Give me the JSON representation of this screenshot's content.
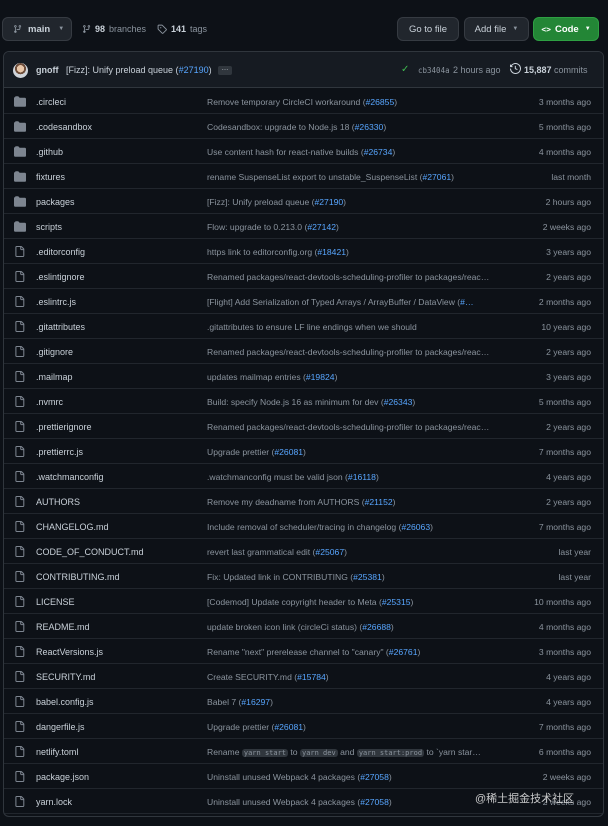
{
  "toolbar": {
    "branch": "main",
    "branches_count": "98",
    "branches_label": "branches",
    "tags_count": "141",
    "tags_label": "tags",
    "goto_file": "Go to file",
    "add_file": "Add file",
    "code": "Code"
  },
  "commit": {
    "author": "gnoff",
    "message_pre": "[Fizz]: Unify preload queue (",
    "message_pr": "#27190",
    "message_post": ")",
    "ellipsis": "…",
    "sha": "cb3404a",
    "time": "2 hours ago",
    "count": "15,887",
    "count_label": "commits"
  },
  "files": [
    {
      "type": "dir",
      "name": ".circleci",
      "msg": "Remove temporary CircleCI workaround (",
      "pr": "#26855",
      "msg_post": ")",
      "age": "3 months ago"
    },
    {
      "type": "dir",
      "name": ".codesandbox",
      "msg": "Codesandbox: upgrade to Node.js 18 (",
      "pr": "#26330",
      "msg_post": ")",
      "age": "5 months ago"
    },
    {
      "type": "dir",
      "name": ".github",
      "msg": "Use content hash for react-native builds (",
      "pr": "#26734",
      "msg_post": ")",
      "age": "4 months ago"
    },
    {
      "type": "dir",
      "name": "fixtures",
      "msg": "rename SuspenseList export to unstable_SuspenseList (",
      "pr": "#27061",
      "msg_post": ")",
      "age": "last month"
    },
    {
      "type": "dir",
      "name": "packages",
      "msg": "[Fizz]: Unify preload queue (",
      "pr": "#27190",
      "msg_post": ")",
      "age": "2 hours ago"
    },
    {
      "type": "dir",
      "name": "scripts",
      "msg": "Flow: upgrade to 0.213.0 (",
      "pr": "#27142",
      "msg_post": ")",
      "age": "2 weeks ago"
    },
    {
      "type": "file",
      "name": ".editorconfig",
      "msg": "https link to editorconfig.org (",
      "pr": "#18421",
      "msg_post": ")",
      "age": "3 years ago"
    },
    {
      "type": "file",
      "name": ".eslintignore",
      "msg": "Renamed packages/react-devtools-scheduling-profiler to packages/reac…",
      "pr": "",
      "msg_post": "",
      "age": "2 years ago"
    },
    {
      "type": "file",
      "name": ".eslintrc.js",
      "msg": "[Flight] Add Serialization of Typed Arrays / ArrayBuffer / DataView (",
      "pr": "#…",
      "msg_post": "",
      "age": "2 months ago"
    },
    {
      "type": "file",
      "name": ".gitattributes",
      "msg": ".gitattributes to ensure LF line endings when we should",
      "pr": "",
      "msg_post": "",
      "age": "10 years ago"
    },
    {
      "type": "file",
      "name": ".gitignore",
      "msg": "Renamed packages/react-devtools-scheduling-profiler to packages/reac…",
      "pr": "",
      "msg_post": "",
      "age": "2 years ago"
    },
    {
      "type": "file",
      "name": ".mailmap",
      "msg": "updates mailmap entries (",
      "pr": "#19824",
      "msg_post": ")",
      "age": "3 years ago"
    },
    {
      "type": "file",
      "name": ".nvmrc",
      "msg": "Build: specify Node.js 16 as minimum for dev (",
      "pr": "#26343",
      "msg_post": ")",
      "age": "5 months ago"
    },
    {
      "type": "file",
      "name": ".prettierignore",
      "msg": "Renamed packages/react-devtools-scheduling-profiler to packages/reac…",
      "pr": "",
      "msg_post": "",
      "age": "2 years ago"
    },
    {
      "type": "file",
      "name": ".prettierrc.js",
      "msg": "Upgrade prettier (",
      "pr": "#26081",
      "msg_post": ")",
      "age": "7 months ago"
    },
    {
      "type": "file",
      "name": ".watchmanconfig",
      "msg": ".watchmanconfig must be valid json (",
      "pr": "#16118",
      "msg_post": ")",
      "age": "4 years ago"
    },
    {
      "type": "file",
      "name": "AUTHORS",
      "msg": "Remove my deadname from AUTHORS (",
      "pr": "#21152",
      "msg_post": ")",
      "age": "2 years ago"
    },
    {
      "type": "file",
      "name": "CHANGELOG.md",
      "msg": "Include removal of scheduler/tracing in changelog (",
      "pr": "#26063",
      "msg_post": ")",
      "age": "7 months ago"
    },
    {
      "type": "file",
      "name": "CODE_OF_CONDUCT.md",
      "msg": "revert last grammatical edit (",
      "pr": "#25067",
      "msg_post": ")",
      "age": "last year"
    },
    {
      "type": "file",
      "name": "CONTRIBUTING.md",
      "msg": "Fix: Updated link in CONTRIBUTING (",
      "pr": "#25381",
      "msg_post": ")",
      "age": "last year"
    },
    {
      "type": "file",
      "name": "LICENSE",
      "msg": "[Codemod] Update copyright header to Meta (",
      "pr": "#25315",
      "msg_post": ")",
      "age": "10 months ago"
    },
    {
      "type": "file",
      "name": "README.md",
      "msg": "update broken icon link (circleCi status) (",
      "pr": "#26688",
      "msg_post": ")",
      "age": "4 months ago"
    },
    {
      "type": "file",
      "name": "ReactVersions.js",
      "msg": "Rename \"next\" prerelease channel to \"canary\" (",
      "pr": "#26761",
      "msg_post": ")",
      "age": "3 months ago"
    },
    {
      "type": "file",
      "name": "SECURITY.md",
      "msg": "Create SECURITY.md (",
      "pr": "#15784",
      "msg_post": ")",
      "age": "4 years ago"
    },
    {
      "type": "file",
      "name": "babel.config.js",
      "msg": "Babel 7 (",
      "pr": "#16297",
      "msg_post": ")",
      "age": "4 years ago"
    },
    {
      "type": "file",
      "name": "dangerfile.js",
      "msg": "Upgrade prettier (",
      "pr": "#26081",
      "msg_post": ")",
      "age": "7 months ago"
    },
    {
      "type": "file",
      "name": "netlify.toml",
      "msg": "Rename",
      "codes": [
        "yarn start",
        "yarn dev",
        "yarn start:prod"
      ],
      "joiners": [
        "to",
        "and",
        "to `yarn star…"
      ],
      "pr": "",
      "msg_post": "",
      "age": "6 months ago"
    },
    {
      "type": "file",
      "name": "package.json",
      "msg": "Uninstall unused Webpack 4 packages (",
      "pr": "#27058",
      "msg_post": ")",
      "age": "2 weeks ago"
    },
    {
      "type": "file",
      "name": "yarn.lock",
      "msg": "Uninstall unused Webpack 4 packages (",
      "pr": "#27058",
      "msg_post": ")",
      "age": "2 weeks ago"
    }
  ],
  "watermark": "@稀土掘金技术社区",
  "colors": {
    "accent": "#58a6ff",
    "code_button": "#238636",
    "success": "#3fb950",
    "folder": "#7d8590"
  }
}
